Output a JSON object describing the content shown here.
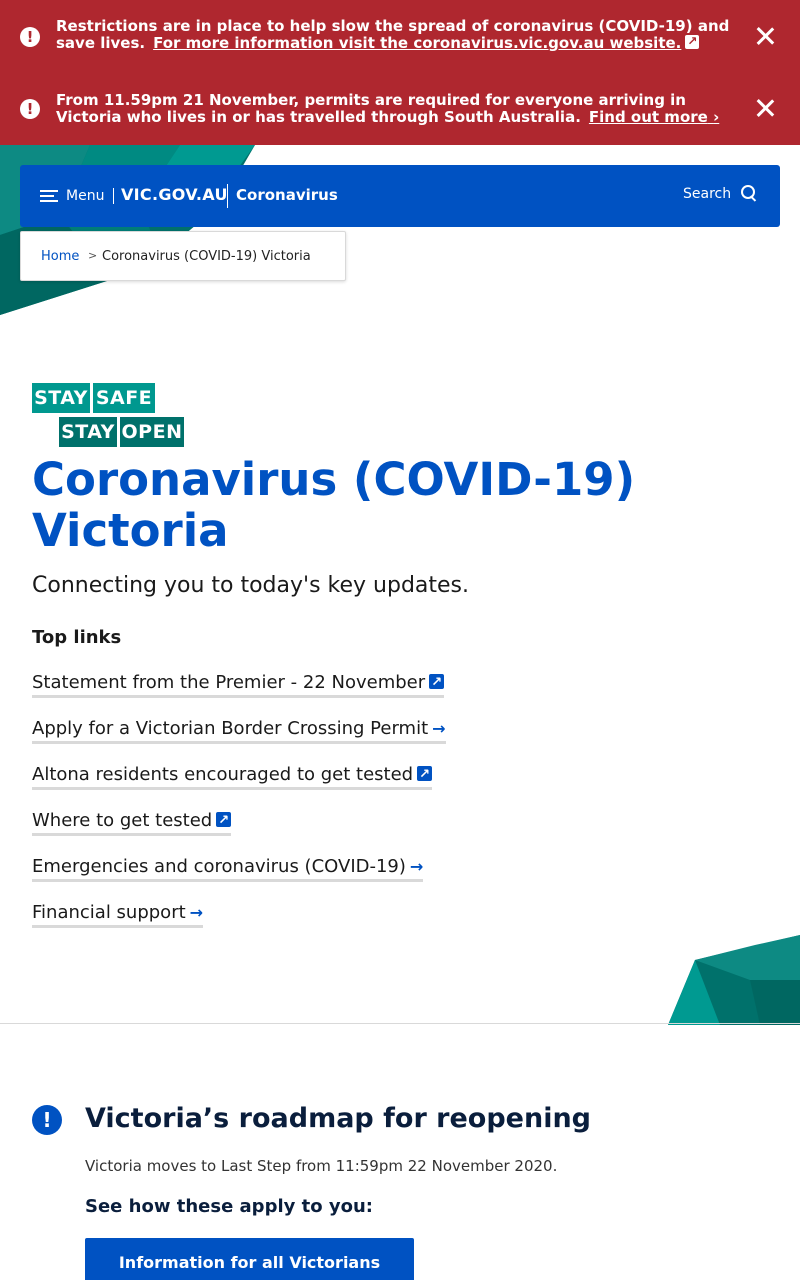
{
  "alerts": [
    {
      "text": "Restrictions are in place to help slow the spread of coronavirus (COVID-19) and save lives.",
      "link": "For more information visit the coronavirus.vic.gov.au website.",
      "link_icon": "external-link-icon"
    },
    {
      "text": "From 11.59pm 21 November, permits are required for everyone arriving in Victoria who lives in or has travelled through South Australia.",
      "link": "Find out more",
      "link_icon": "chevron-right-icon"
    }
  ],
  "navbar": {
    "menu_label": "Menu",
    "brand": "VIC.GOV.AU",
    "site_name": "Coronavirus",
    "search_label": "Search"
  },
  "breadcrumb": {
    "home": "Home",
    "separator": ">",
    "current": "Coronavirus (COVID-19) Victoria"
  },
  "logo": {
    "words": [
      "STAY",
      "SAFE",
      "STAY",
      "OPEN"
    ]
  },
  "hero": {
    "title": "Coronavirus (COVID-19) Victoria",
    "intro": "Connecting you to today's key updates."
  },
  "top_links": {
    "heading": "Top links",
    "items": [
      {
        "label": "Statement from the Premier - 22 November",
        "icon": "external-link-icon"
      },
      {
        "label": "Apply for a Victorian Border Crossing Permit",
        "icon": "arrow-right-icon"
      },
      {
        "label": "Altona residents encouraged to get tested",
        "icon": "external-link-icon"
      },
      {
        "label": "Where to get tested",
        "icon": "external-link-icon"
      },
      {
        "label": "Emergencies and coronavirus (COVID-19)",
        "icon": "arrow-right-icon"
      },
      {
        "label": "Financial support",
        "icon": "arrow-right-icon"
      }
    ]
  },
  "roadmap": {
    "title": "Victoria’s roadmap for reopening",
    "text": "Victoria moves to Last Step from 11:59pm 22 November 2020.",
    "subheading": "See how these apply to you:",
    "button": "Information for all Victorians"
  },
  "colors": {
    "alert_red": "#af272f",
    "primary_blue": "#0052c2",
    "teal": "#00988f",
    "dark_teal": "#00716b"
  }
}
